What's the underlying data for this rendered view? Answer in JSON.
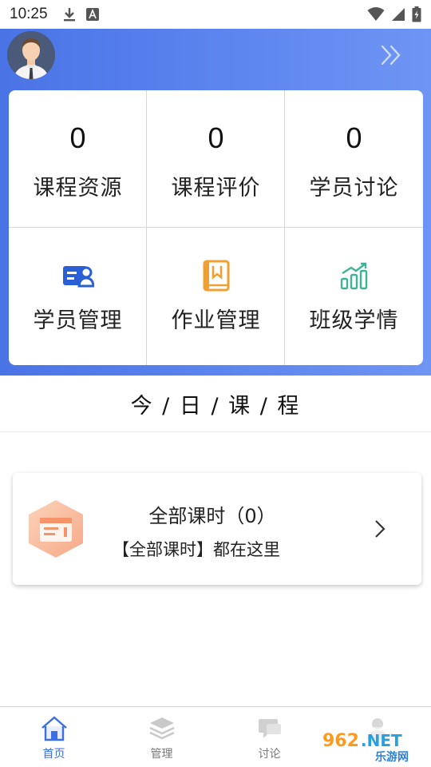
{
  "status_bar": {
    "time": "10:25"
  },
  "stats": [
    {
      "value": "0",
      "label": "课程资源"
    },
    {
      "value": "0",
      "label": "课程评价"
    },
    {
      "value": "0",
      "label": "学员讨论"
    }
  ],
  "tools": [
    {
      "icon": "student-card-icon",
      "label": "学员管理",
      "color": "#2a5fd6"
    },
    {
      "icon": "homework-book-icon",
      "label": "作业管理",
      "color": "#f0a030"
    },
    {
      "icon": "bar-chart-icon",
      "label": "班级学情",
      "color": "#3fb39a"
    }
  ],
  "today": {
    "title": "今 / 日 / 课 / 程"
  },
  "course_card": {
    "title": "全部课时（0）",
    "subtitle": "【全部课时】都在这里"
  },
  "bottom_nav": [
    {
      "label": "首页",
      "active": true
    },
    {
      "label": "管理",
      "active": false
    },
    {
      "label": "讨论",
      "active": false
    },
    {
      "label": "",
      "active": false
    }
  ],
  "watermark": {
    "brand": "962.NET",
    "sub": "乐游网"
  },
  "colors": {
    "header_gradient_start": "#4a73e6",
    "header_gradient_end": "#6e95f4",
    "active_nav": "#3c6fe0"
  }
}
